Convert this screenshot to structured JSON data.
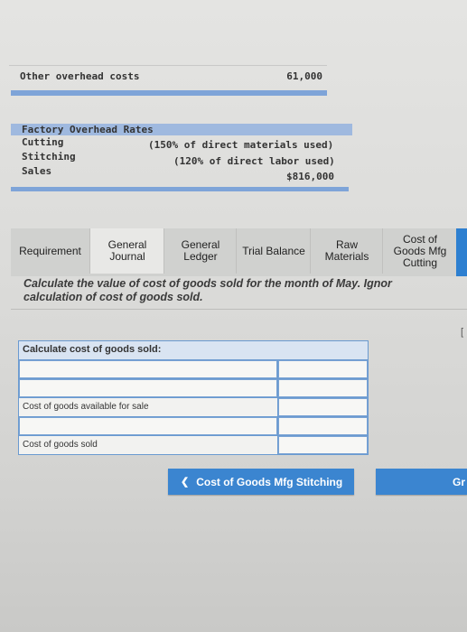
{
  "top": {
    "label": "Other overhead costs",
    "value": "61,000"
  },
  "rates": {
    "header": "Factory Overhead Rates",
    "rows": [
      {
        "label": "Cutting",
        "value": "(150% of direct materials used)"
      },
      {
        "label": "Stitching",
        "value": "(120% of direct labor used)"
      },
      {
        "label": "Sales",
        "value": "$816,000"
      }
    ]
  },
  "tabs": [
    {
      "label": "Requirement"
    },
    {
      "label": "General\nJournal"
    },
    {
      "label": "General\nLedger"
    },
    {
      "label": "Trial Balance"
    },
    {
      "label": "Raw\nMaterials"
    },
    {
      "label": "Cost of\nGoods Mfg\nCutting"
    }
  ],
  "instructions": {
    "line1": "Calculate the value of cost of goods sold for the month of May. Ignor",
    "line2": "calculation of cost of goods sold."
  },
  "cogs_table": {
    "header": "Calculate cost of goods sold:",
    "rows": [
      {
        "label": "",
        "value": ""
      },
      {
        "label": "",
        "value": ""
      },
      {
        "label": "Cost of goods available for sale",
        "value": ""
      },
      {
        "label": "",
        "value": ""
      },
      {
        "label": "Cost of goods sold",
        "value": ""
      }
    ]
  },
  "nav": {
    "prev_label": "Cost of Goods Mfg Stitching",
    "prev_icon": "chevron-left-icon",
    "next_label": "Gr"
  },
  "colors": {
    "accent": "#3b85d0",
    "table_border": "#6a9ad0",
    "header_fill": "#9fb9df"
  }
}
